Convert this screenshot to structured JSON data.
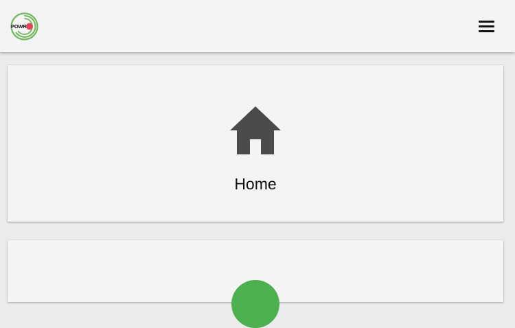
{
  "header": {
    "logo_text": "POWR",
    "menu_icon": "hamburger-menu-icon"
  },
  "cards": [
    {
      "label": "Home",
      "icon": "house-icon",
      "icon_color": "#4a4a4a"
    },
    {
      "label": "",
      "icon": "green-circle-icon",
      "icon_color": "#4caf50"
    }
  ],
  "colors": {
    "background": "#ececec",
    "surface": "#f4f4f4",
    "logo_green": "#6fb85a",
    "logo_red": "#e2455a"
  }
}
